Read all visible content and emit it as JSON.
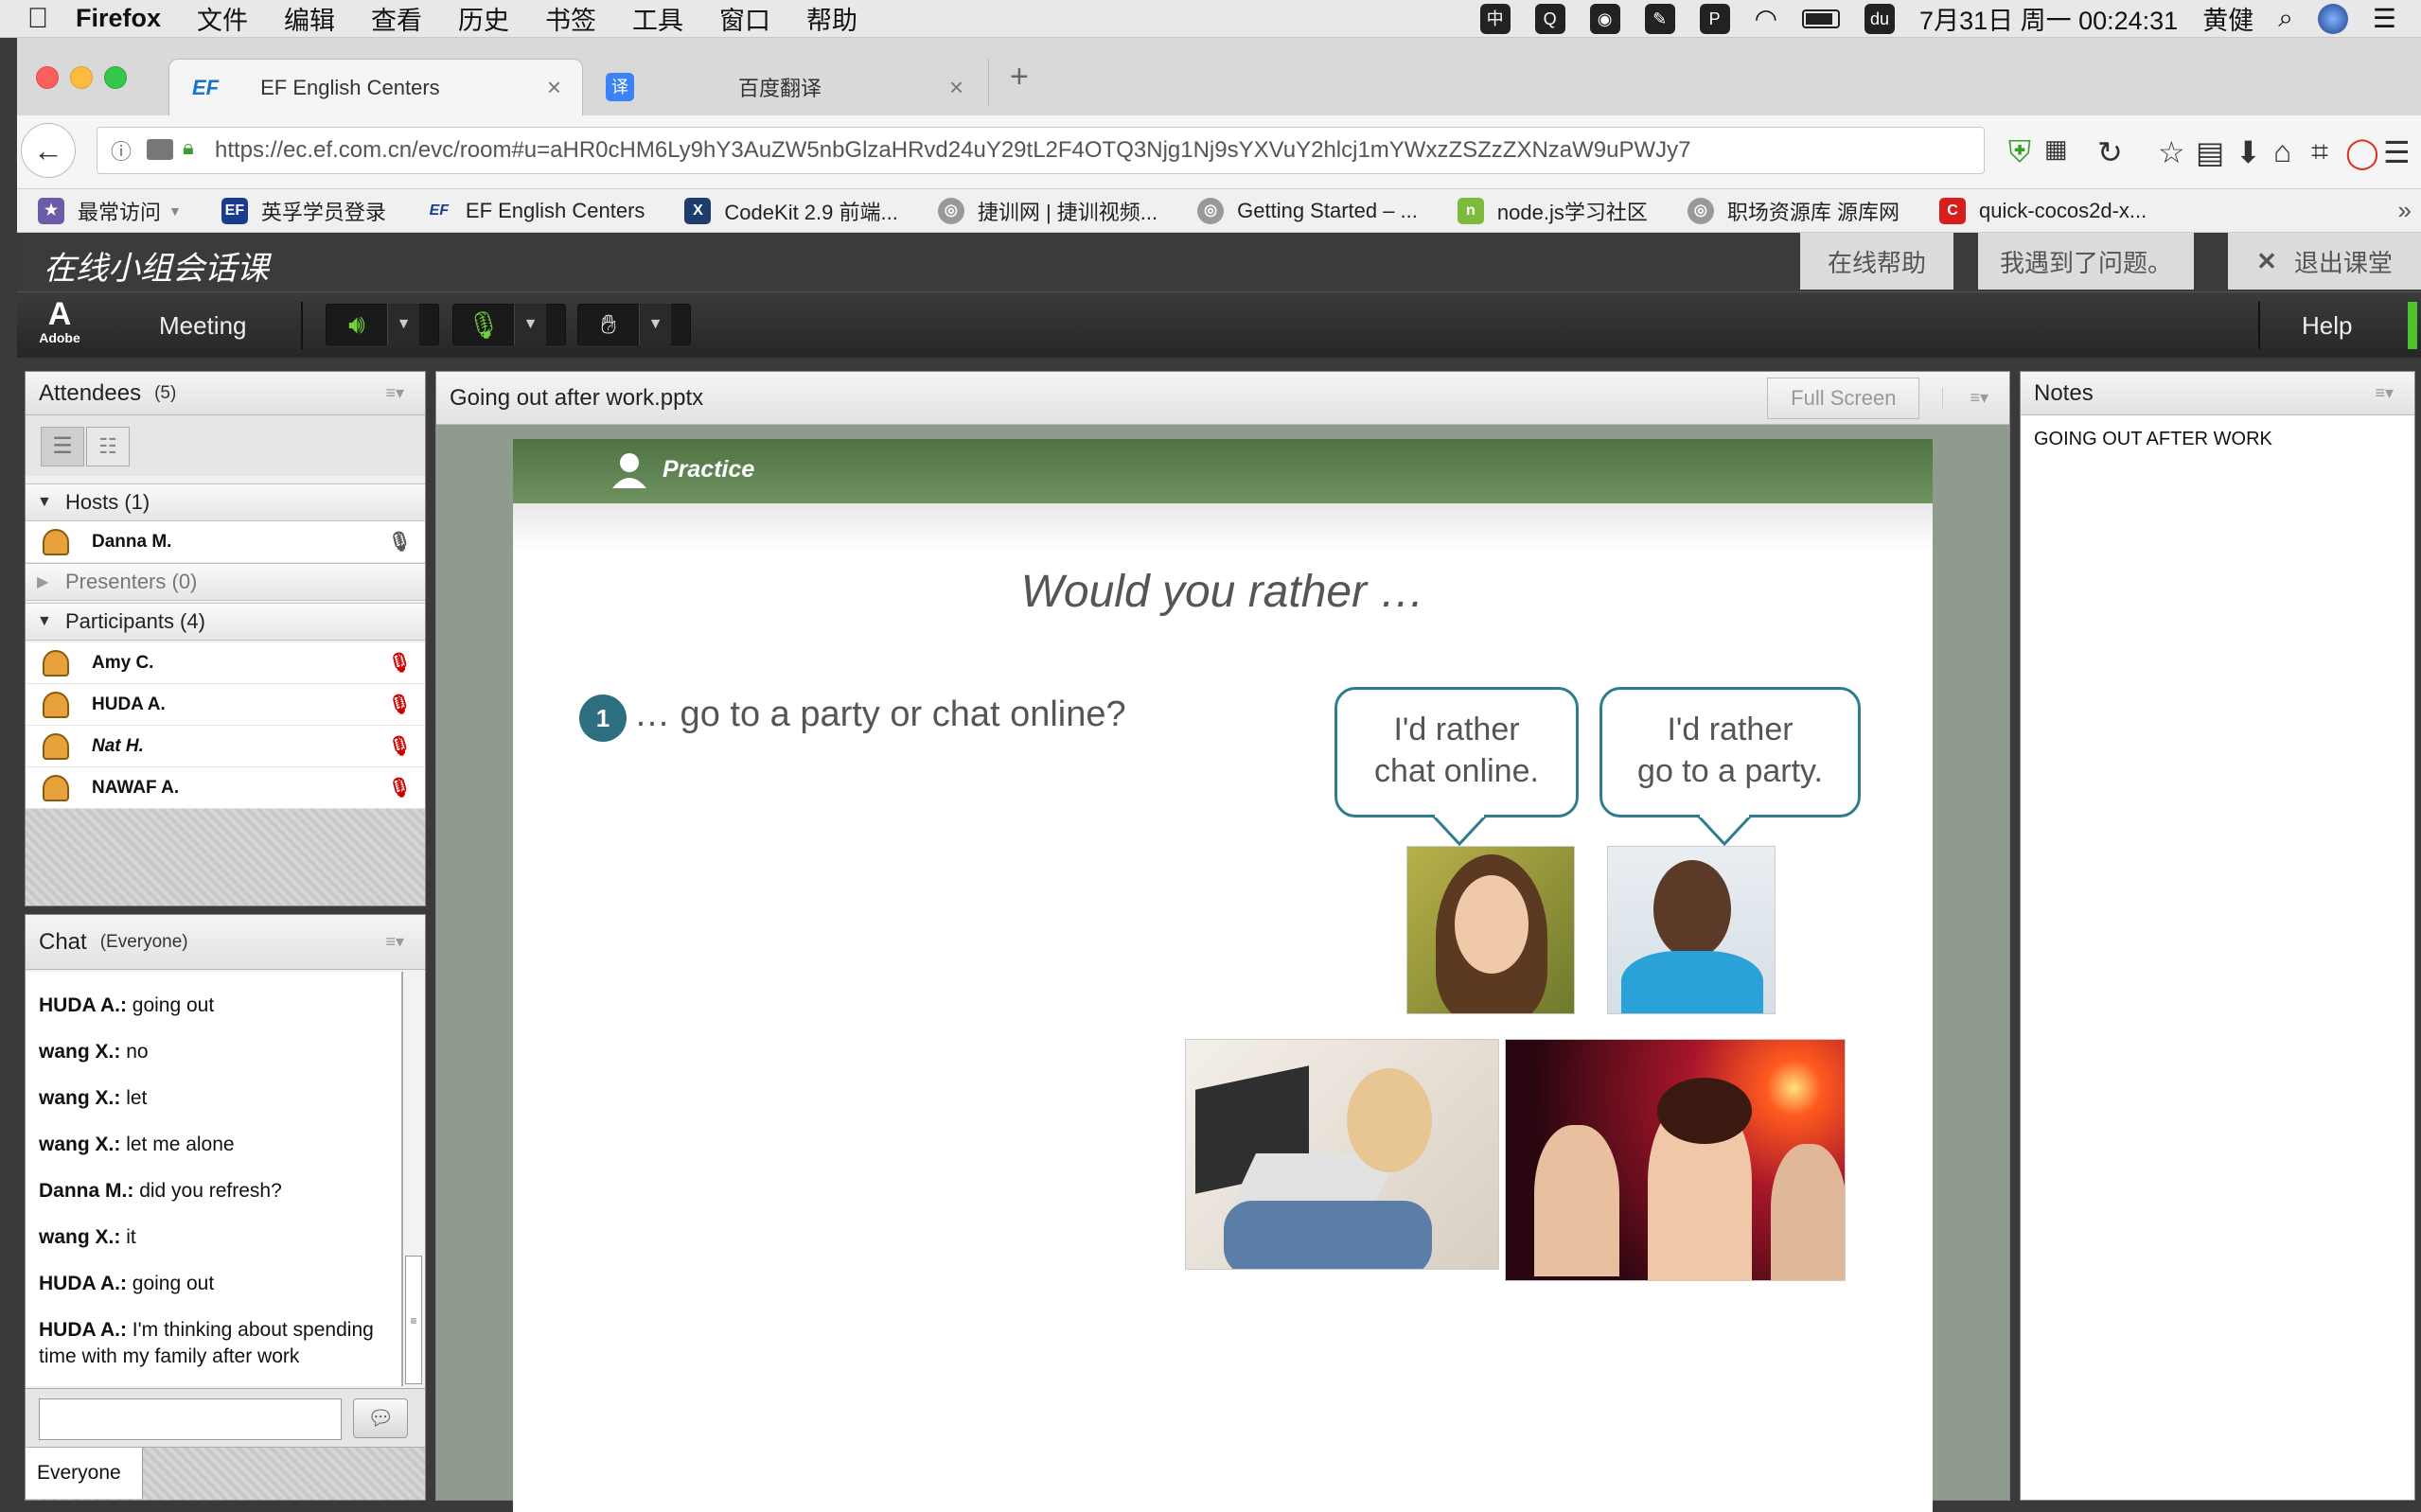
{
  "menubar": {
    "apple": "",
    "app": "Firefox",
    "items": [
      "文件",
      "编辑",
      "查看",
      "历史",
      "书签",
      "工具",
      "窗口",
      "帮助"
    ],
    "status": {
      "datetime": "7月31日 周一  00:24:31",
      "user": "黄健"
    }
  },
  "browser": {
    "tabs": [
      {
        "icon": "EF",
        "label": "EF English Centers",
        "close": "×"
      },
      {
        "icon": "译",
        "label": "百度翻译",
        "close": "×"
      }
    ],
    "new_tab": "+",
    "url": "https://ec.ef.com.cn/evc/room#u=aHR0cHM6Ly9hY3AuZW5nbGlzaHRvd24uY29tL2F4OTQ3Njg1Nj9sYXVuY2hlcj1mYWxzZSZzZXNzaW9uPWJy7",
    "bookmarks": [
      {
        "icon": "★",
        "label": "最常访问"
      },
      {
        "icon": "EF",
        "label": "英孚学员登录"
      },
      {
        "icon": "EF",
        "label": "EF English Centers"
      },
      {
        "icon": "X",
        "label": "CodeKit 2.9 前端..."
      },
      {
        "icon": "◎",
        "label": "捷训网 | 捷训视频..."
      },
      {
        "icon": "◎",
        "label": "Getting Started – ..."
      },
      {
        "icon": "n",
        "label": "node.js学习社区"
      },
      {
        "icon": "◎",
        "label": "职场资源库 源库网"
      },
      {
        "icon": "C",
        "label": "quick-cocos2d-x..."
      }
    ],
    "overflow": "»"
  },
  "app": {
    "title": "在线小组会话课",
    "buttons": {
      "help": "在线帮助",
      "problem": "我遇到了问题。",
      "exit": "退出课堂",
      "exit_icon": "✕"
    }
  },
  "toolbar": {
    "logo": "Adobe",
    "meeting": "Meeting",
    "help": "Help"
  },
  "attendees": {
    "title": "Attendees",
    "count": "(5)",
    "menu": "≡▾",
    "hosts": {
      "label": "Hosts (1)",
      "people": [
        {
          "name": "Danna M."
        }
      ]
    },
    "presenters": {
      "label": "Presenters (0)"
    },
    "participants": {
      "label": "Participants (4)",
      "people": [
        {
          "name": "Amy C."
        },
        {
          "name": "HUDA A."
        },
        {
          "name": "Nat H."
        },
        {
          "name": "NAWAF A."
        }
      ]
    }
  },
  "chat": {
    "title": "Chat",
    "scope": "(Everyone)",
    "menu": "≡▾",
    "messages": [
      {
        "sender": "HUDA A.:",
        "text": "going out"
      },
      {
        "sender": "wang X.:",
        "text": "no"
      },
      {
        "sender": "wang X.:",
        "text": "let"
      },
      {
        "sender": "wang X.:",
        "text": "let me alone"
      },
      {
        "sender": "Danna M.:",
        "text": "did you refresh?"
      },
      {
        "sender": "wang X.:",
        "text": "it"
      },
      {
        "sender": "HUDA A.:",
        "text": "going out"
      },
      {
        "sender": "HUDA A.:",
        "text": "I'm thinking about spending time with my family after work"
      }
    ],
    "input": "",
    "recipient": "Everyone"
  },
  "share": {
    "title": "Going out after work.pptx",
    "fullscreen": "Full Screen",
    "menu": "≡▾",
    "slide": {
      "banner": "Practice",
      "heading": "Would you rather …",
      "number": "1",
      "question": "… go to a party or chat online?",
      "bubble1": [
        "I'd rather",
        "chat online."
      ],
      "bubble2": [
        "I'd rather",
        "go to a party."
      ]
    }
  },
  "notes": {
    "title": "Notes",
    "menu": "≡▾",
    "content": "GOING OUT AFTER WORK"
  }
}
